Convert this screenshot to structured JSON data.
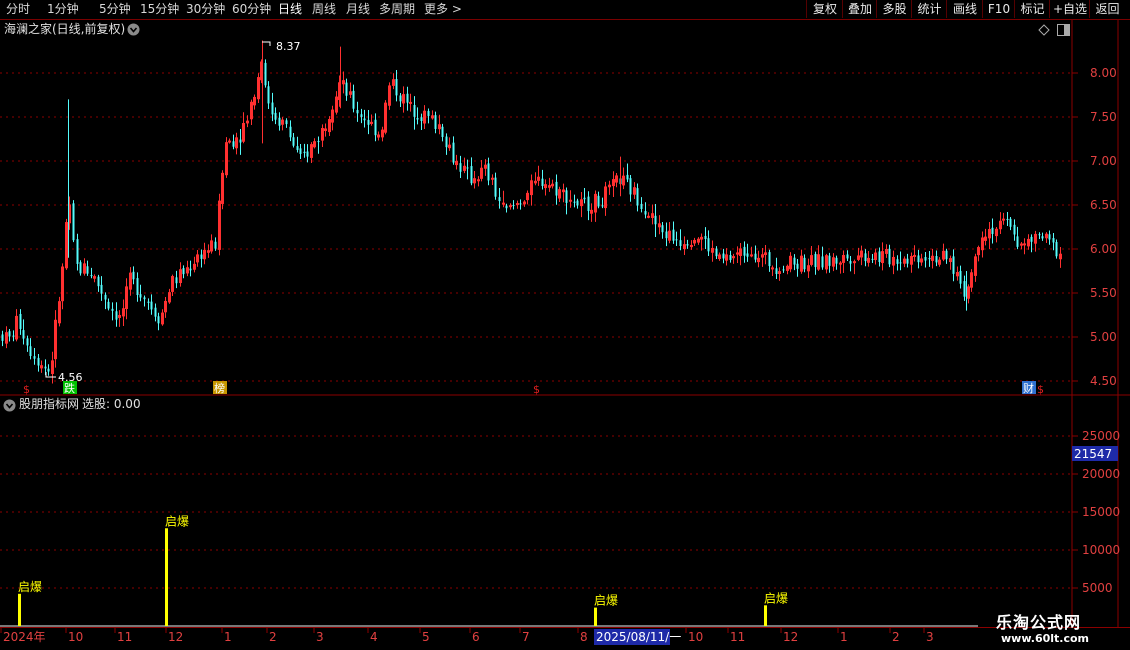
{
  "toolbar": {
    "periods": [
      "分时",
      "1分钟",
      "5分钟",
      "15分钟",
      "30分钟",
      "60分钟",
      "日线",
      "周线",
      "月线",
      "多周期",
      "更多"
    ],
    "active_period": "日线",
    "more_arrow": ">",
    "right_buttons": [
      "复权",
      "叠加",
      "多股",
      "统计",
      "画线",
      "F10",
      "标记",
      "+自选",
      "返回"
    ]
  },
  "main_panel": {
    "title": "海澜之家(日线,前复权)",
    "price_axis": [
      "8.00",
      "7.50",
      "7.00",
      "6.50",
      "6.00",
      "5.50",
      "5.00",
      "4.50"
    ],
    "high_label": "8.37",
    "low_label": "4.56",
    "event_markers": [
      {
        "label": "$",
        "color": "#e02020"
      },
      {
        "label": "跌",
        "color": "#00c000"
      },
      {
        "label": "榜",
        "color": "#c89600"
      },
      {
        "label": "$",
        "color": "#e02020"
      },
      {
        "label": "财",
        "color": "#3070d0"
      },
      {
        "label": "$",
        "color": "#e02020"
      }
    ]
  },
  "sub_panel": {
    "title": "股朋指标网",
    "value_label": "选股: 0.00",
    "axis_labels": [
      "25000",
      "20000",
      "15000",
      "10000",
      "5000"
    ],
    "current_value": "21547",
    "signal_label": "启爆",
    "signals": [
      {
        "label": "启爆",
        "level": 0.28
      },
      {
        "label": "启爆",
        "level": 0.85
      },
      {
        "label": "启爆",
        "level": 0.16
      },
      {
        "label": "启爆",
        "level": 0.18
      }
    ]
  },
  "time_axis": {
    "labels": [
      "2024年",
      "10",
      "11",
      "12",
      "1",
      "2",
      "3",
      "4",
      "5",
      "6",
      "7",
      "8",
      "2025/08/11/一",
      "10",
      "11",
      "12",
      "1",
      "2",
      "3"
    ]
  },
  "watermark": {
    "title": "乐淘公式网",
    "url": "www.60lt.com"
  },
  "colors": {
    "up": "#ff3030",
    "down": "#54fcfc",
    "grid": "#8b0000",
    "signal": "#ffff00",
    "axis_text": "#e04040"
  }
}
